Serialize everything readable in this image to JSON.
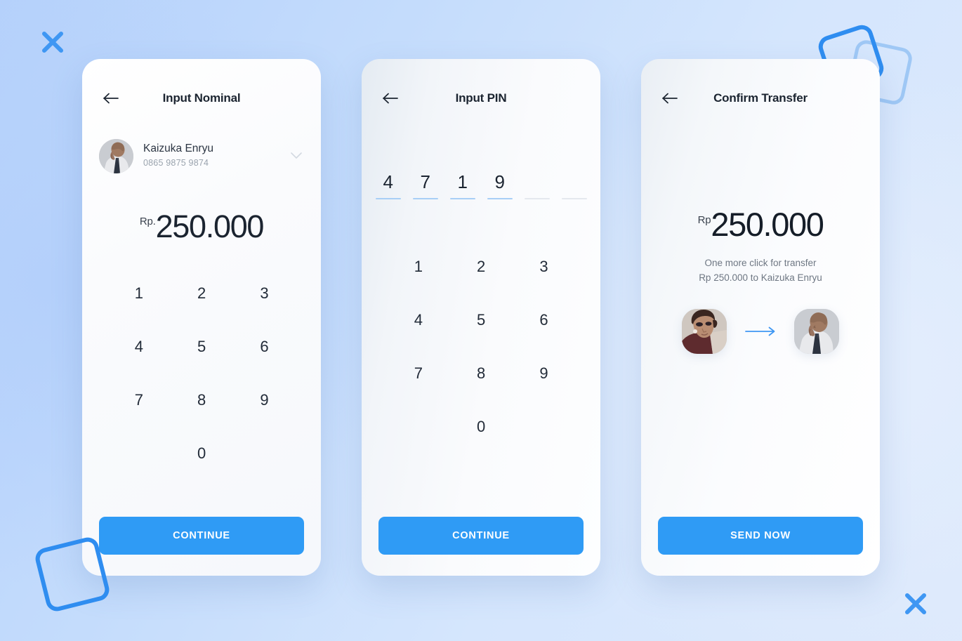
{
  "background": {
    "gradient_from": "#b5d1fb",
    "gradient_to": "#dde9fc",
    "accent": "#3f97f3"
  },
  "decorations": [
    {
      "name": "x-mark-top-left",
      "type": "x-mark",
      "color": "#3f97f3"
    },
    {
      "name": "x-mark-bottom-right",
      "type": "x-mark",
      "color": "#3f97f3"
    },
    {
      "name": "rounded-square-top-right-solid",
      "type": "square",
      "color": "#2f8df0"
    },
    {
      "name": "rounded-square-top-right-faint",
      "type": "square",
      "color": "#9fc8f5"
    },
    {
      "name": "rounded-square-bottom-left",
      "type": "square",
      "color": "#2f8df0"
    }
  ],
  "screens": [
    {
      "id": "input-nominal",
      "title": "Input Nominal",
      "back_label": "Back",
      "contact": {
        "name": "Kaizuka Enryu",
        "phone": "0865 9875 9874",
        "avatar_name": "contact-avatar",
        "chevron_name": "chevron-down-icon"
      },
      "amount": {
        "currency": "Rp.",
        "value": "250.000"
      },
      "keypad": [
        "1",
        "2",
        "3",
        "4",
        "5",
        "6",
        "7",
        "8",
        "9",
        "0"
      ],
      "cta": "CONTINUE"
    },
    {
      "id": "input-pin",
      "title": "Input PIN",
      "back_label": "Back",
      "pin": {
        "length": 6,
        "digits": [
          "4",
          "7",
          "1",
          "9",
          "",
          ""
        ],
        "filled_color": "#a8cff6",
        "empty_color": "#e4e8ee"
      },
      "keypad": [
        "1",
        "2",
        "3",
        "4",
        "5",
        "6",
        "7",
        "8",
        "9",
        "0"
      ],
      "cta": "CONTINUE"
    },
    {
      "id": "confirm-transfer",
      "title": "Confirm Transfer",
      "back_label": "Back",
      "amount": {
        "currency": "Rp",
        "value": "250.000"
      },
      "note_line1": "One more click for transfer",
      "note_line2": "Rp 250.000 to Kaizuka Enryu",
      "sender_avatar_name": "sender-avatar",
      "recipient_avatar_name": "recipient-avatar",
      "arrow_name": "arrow-right-icon",
      "cta": "SEND NOW"
    }
  ]
}
